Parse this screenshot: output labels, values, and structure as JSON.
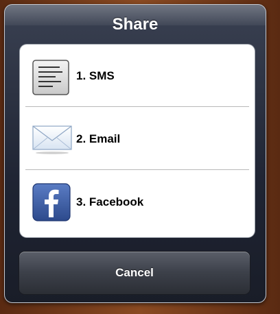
{
  "dialog": {
    "title": "Share",
    "items": [
      {
        "label": "1. SMS",
        "icon": "sms-icon"
      },
      {
        "label": "2. Email",
        "icon": "email-icon"
      },
      {
        "label": "3. Facebook",
        "icon": "facebook-icon"
      }
    ],
    "cancel_label": "Cancel"
  },
  "colors": {
    "dialog_bg": "#1f2433",
    "list_bg": "#ffffff",
    "facebook_blue": "#3b5998"
  }
}
